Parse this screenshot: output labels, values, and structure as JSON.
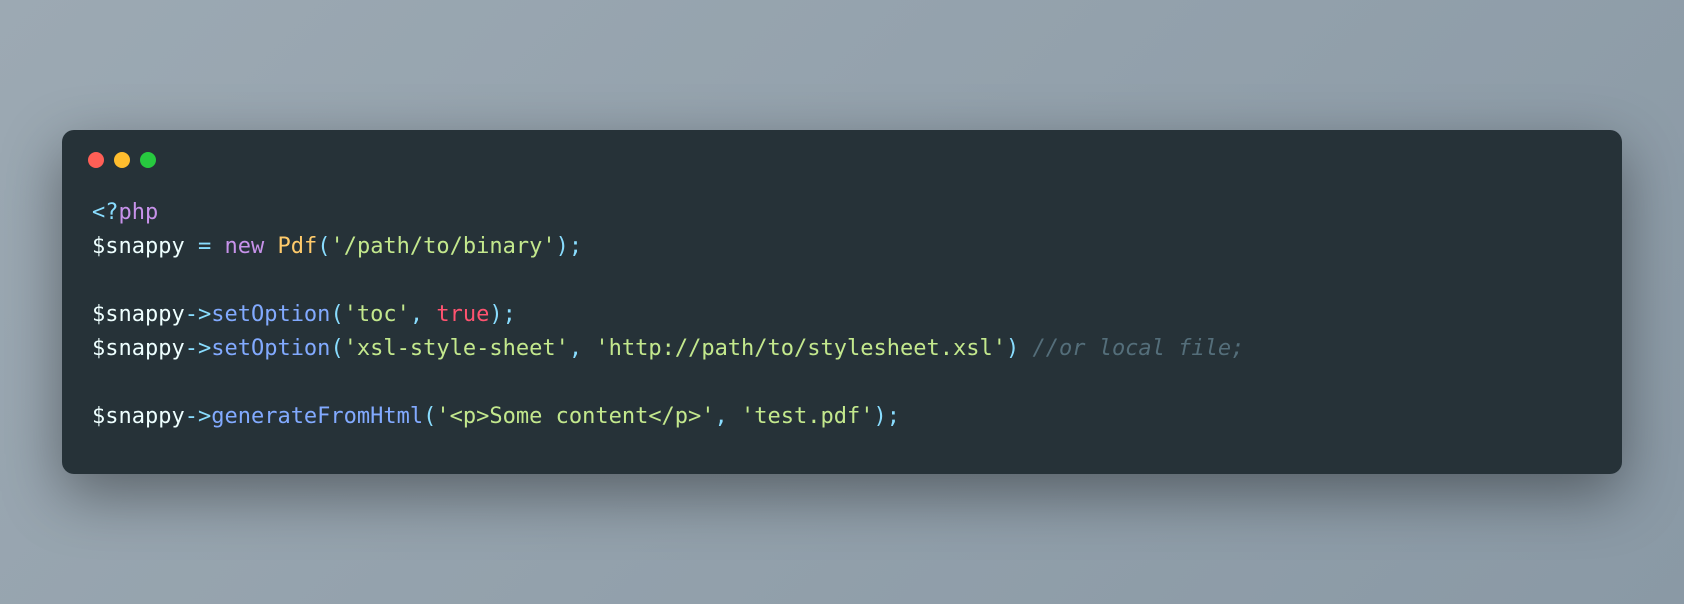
{
  "code": {
    "line1": {
      "open": "<?",
      "php": "php"
    },
    "line2": {
      "var": "$snappy",
      "eq": " = ",
      "new": "new",
      "cls": " Pdf",
      "open_paren": "(",
      "path": "'/path/to/binary'",
      "close": ");"
    },
    "line3": {
      "var": "$snappy",
      "arrow": "->",
      "method": "setOption",
      "open_paren": "(",
      "arg1": "'toc'",
      "comma": ", ",
      "bool": "true",
      "close": ");"
    },
    "line4": {
      "var": "$snappy",
      "arrow": "->",
      "method": "setOption",
      "open_paren": "(",
      "arg1": "'xsl-style-sheet'",
      "comma": ", ",
      "arg2": "'http://path/to/stylesheet.xsl'",
      "close_paren": ")",
      "space": " ",
      "comment": "//or local file;"
    },
    "line5": {
      "var": "$snappy",
      "arrow": "->",
      "method": "generateFromHtml",
      "open_paren": "(",
      "arg1": "'<p>Some content</p>'",
      "comma": ", ",
      "arg2": "'test.pdf'",
      "close": ");"
    }
  }
}
